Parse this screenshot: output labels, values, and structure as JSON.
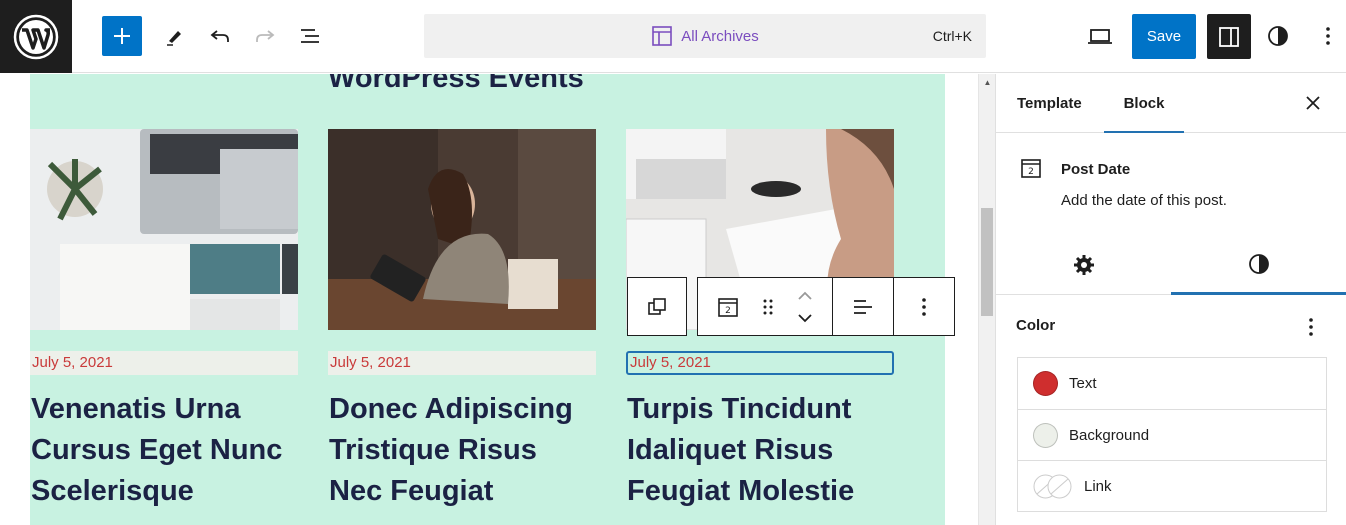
{
  "header": {
    "command_title": "All Archives",
    "command_shortcut": "Ctrl+K",
    "save_label": "Save"
  },
  "canvas": {
    "section_title": "WordPress Events",
    "background_color": "#c8f2e1",
    "posts": [
      {
        "date": "July 5, 2021",
        "title": "Venenatis Urna Cursus Eget Nunc Scelerisque"
      },
      {
        "date": "July 5, 2021",
        "title": "Donec Adipiscing Tristique Risus Nec Feugiat"
      },
      {
        "date": "July 5, 2021",
        "title": "Turpis Tincidunt Idaliquet Risus Feugiat Molestie"
      }
    ]
  },
  "sidebar": {
    "tabs": {
      "template": "Template",
      "block": "Block"
    },
    "block_card": {
      "title": "Post Date",
      "description": "Add the date of this post."
    },
    "color_panel": {
      "heading": "Color",
      "items": [
        {
          "label": "Text",
          "color": "#cf2e2e"
        },
        {
          "label": "Background",
          "color": "#edf0ea"
        },
        {
          "label": "Link",
          "color": "#ffffff"
        }
      ]
    }
  },
  "colors": {
    "accent": "#0073c7",
    "title_text": "#1b2244",
    "date_text": "#c93a3a"
  }
}
